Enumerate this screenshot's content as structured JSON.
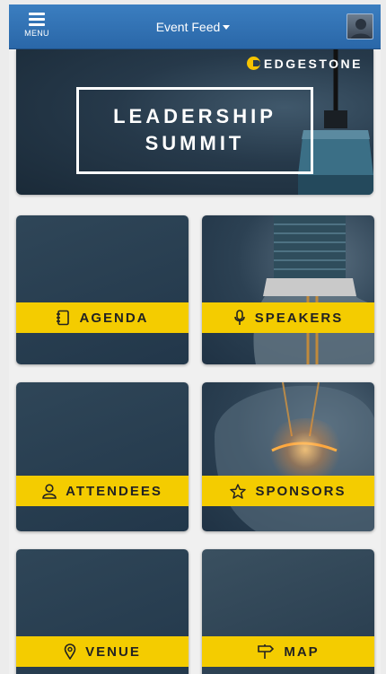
{
  "header": {
    "menu_label": "MENU",
    "title": "Event Feed"
  },
  "banner": {
    "brand": "EDGESTONE",
    "title_line1": "LEADERSHIP",
    "title_line2": "SUMMIT"
  },
  "tiles": [
    {
      "label": "AGENDA",
      "icon": "notebook-icon"
    },
    {
      "label": "SPEAKERS",
      "icon": "microphone-icon"
    },
    {
      "label": "ATTENDEES",
      "icon": "person-icon"
    },
    {
      "label": "SPONSORS",
      "icon": "star-icon"
    },
    {
      "label": "VENUE",
      "icon": "map-pin-icon"
    },
    {
      "label": "MAP",
      "icon": "signpost-icon"
    }
  ],
  "colors": {
    "header": "#2f6fb2",
    "band": "#f4cc00",
    "tile": "#27394a"
  }
}
